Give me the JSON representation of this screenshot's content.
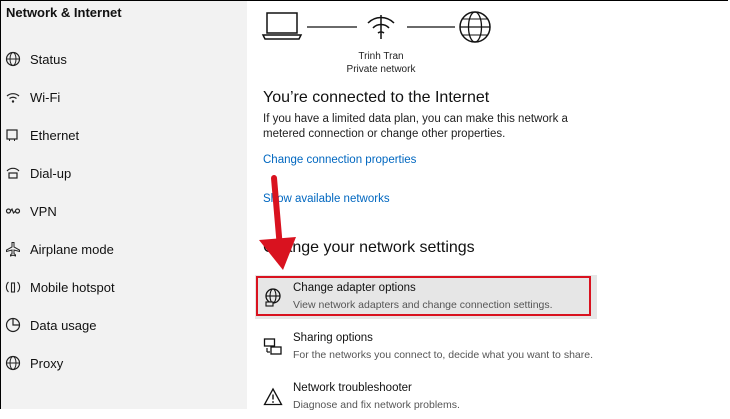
{
  "sidebar": {
    "title": "Network & Internet",
    "items": [
      {
        "label": "Status",
        "icon": "globe-icon"
      },
      {
        "label": "Wi-Fi",
        "icon": "wifi-icon"
      },
      {
        "label": "Ethernet",
        "icon": "ethernet-icon"
      },
      {
        "label": "Dial-up",
        "icon": "dialup-icon"
      },
      {
        "label": "VPN",
        "icon": "vpn-icon"
      },
      {
        "label": "Airplane mode",
        "icon": "airplane-icon"
      },
      {
        "label": "Mobile hotspot",
        "icon": "hotspot-icon"
      },
      {
        "label": "Data usage",
        "icon": "data-usage-icon"
      },
      {
        "label": "Proxy",
        "icon": "globe-icon"
      }
    ]
  },
  "main": {
    "network_name": "Trinh Tran",
    "network_type": "Private network",
    "connected_heading": "You’re connected to the Internet",
    "connected_desc": "If you have a limited data plan, you can make this network a metered connection or change other properties.",
    "link_change_props": "Change connection properties",
    "link_show_networks": "Show available networks",
    "change_heading": "Change your network settings",
    "options": [
      {
        "title": "Change adapter options",
        "desc": "View network adapters and change connection settings.",
        "icon": "adapter-icon"
      },
      {
        "title": "Sharing options",
        "desc": "For the networks you connect to, decide what you want to share.",
        "icon": "sharing-icon"
      },
      {
        "title": "Network troubleshooter",
        "desc": "Diagnose and fix network problems.",
        "icon": "warning-icon"
      }
    ]
  },
  "colors": {
    "link": "#0067c0",
    "highlight_box": "#d9121f",
    "arrow": "#d9121f",
    "sidebar_bg": "#f2f2f2"
  }
}
